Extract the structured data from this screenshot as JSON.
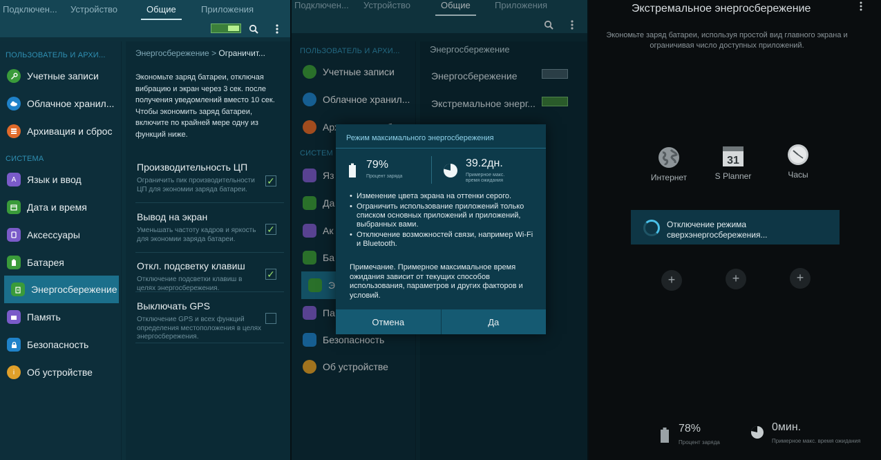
{
  "panel1": {
    "tabs": [
      "Подключен...",
      "Устройство",
      "Общие",
      "Приложения"
    ],
    "active_tab": 2,
    "sidebar": {
      "section_user": "ПОЛЬЗОВАТЕЛЬ И АРХИ...",
      "section_system": "СИСТЕМА",
      "items_user": [
        {
          "label": "Учетные записи",
          "icon": "key-icon",
          "color": "#3a9b3a"
        },
        {
          "label": "Облачное хранил...",
          "icon": "cloud-icon",
          "color": "#1f82c9"
        },
        {
          "label": "Архивация и сброс",
          "icon": "backup-icon",
          "color": "#e06a2a"
        }
      ],
      "items_system": [
        {
          "label": "Язык и ввод",
          "icon": "language-icon",
          "color": "#7a5bc9"
        },
        {
          "label": "Дата и время",
          "icon": "calendar-icon",
          "color": "#3a9b3a"
        },
        {
          "label": "Аксессуары",
          "icon": "accessory-icon",
          "color": "#7a5bc9"
        },
        {
          "label": "Батарея",
          "icon": "battery-icon",
          "color": "#3a9b3a"
        },
        {
          "label": "Энергосбережение",
          "icon": "power-saving-icon",
          "color": "#3a9b3a"
        },
        {
          "label": "Память",
          "icon": "storage-icon",
          "color": "#7a5bc9"
        },
        {
          "label": "Безопасность",
          "icon": "lock-icon",
          "color": "#1f82c9"
        },
        {
          "label": "Об устройстве",
          "icon": "info-icon",
          "color": "#e0a02a"
        }
      ],
      "selected": "Энергосбережение"
    },
    "detail": {
      "breadcrumb_parent": "Энергосбережение",
      "breadcrumb_sep": ">",
      "breadcrumb_current": "Ограничит...",
      "description": "Экономьте заряд батареи, отключая вибрацию и экран через 3 сек. после получения уведомлений вместо 10 сек. Чтобы экономить заряд батареи, включите по крайней мере одну из функций ниже.",
      "options": [
        {
          "title": "Производительность ЦП",
          "subtitle": "Ограничить пик производительности ЦП для экономии заряда батареи.",
          "checked": true
        },
        {
          "title": "Вывод на экран",
          "subtitle": "Уменьшать частоту кадров и яркость для экономии заряда батареи.",
          "checked": true
        },
        {
          "title": "Откл. подсветку клавиш",
          "subtitle": "Отключение подсветки клавиш в целях энергосбережения.",
          "checked": true
        },
        {
          "title": "Выключать GPS",
          "subtitle": "Отключение GPS и всех функций определения местоположения в целях энергосбережения.",
          "checked": false
        }
      ],
      "checkmark": "✓"
    }
  },
  "panel2": {
    "tabs": [
      "Подключен...",
      "Устройство",
      "Общие",
      "Приложения"
    ],
    "sidebar": {
      "section_user": "ПОЛЬЗОВАТЕЛЬ И АРХИ...",
      "section_system": "СИСТЕМ",
      "items": [
        "Учетные записи",
        "Облачное хранил...",
        "Архивация и сброс",
        "Яз",
        "Да",
        "Ак",
        "Ба",
        "Эн",
        "Па",
        "Безопасность",
        "Об устройстве"
      ]
    },
    "detail": {
      "header": "Энергосбережение",
      "row1_label": "Энергосбережение",
      "row2_label": "Экстремальное энерг..."
    },
    "dialog": {
      "title": "Режим максимального энергосбережения",
      "battery_value": "79%",
      "battery_label": "Процент заряда",
      "standby_value": "39.2дн.",
      "standby_label": "Примерное макс. время ожидания",
      "bullets": [
        "Изменение цвета экрана на оттенки серого.",
        "Ограничить использование приложений только списком основных приложений и приложений, выбранных вами.",
        "Отключение возможностей связи, например Wi-Fi и Bluetooth."
      ],
      "note": "Примечание. Примерное максимальное время ожидания зависит от текущих способов использования, параметров и других факторов и условий.",
      "cancel": "Отмена",
      "ok": "Да"
    }
  },
  "panel3": {
    "title": "Экстремальное энергосбережение",
    "description": "Экономьте заряд батареи, используя простой вид главного экрана и ограничивая число доступных приложений.",
    "apps": [
      {
        "label": "Интернет",
        "icon": "globe-icon"
      },
      {
        "label": "S Planner",
        "icon": "calendar-icon",
        "day": "31"
      },
      {
        "label": "Часы",
        "icon": "clock-icon"
      }
    ],
    "toast": "Отключение режима сверхэнергосбережения...",
    "plus": "+",
    "battery_value": "78%",
    "battery_label": "Процент заряда",
    "standby_value": "0мин.",
    "standby_label": "Примерное макс. время ожидания"
  }
}
